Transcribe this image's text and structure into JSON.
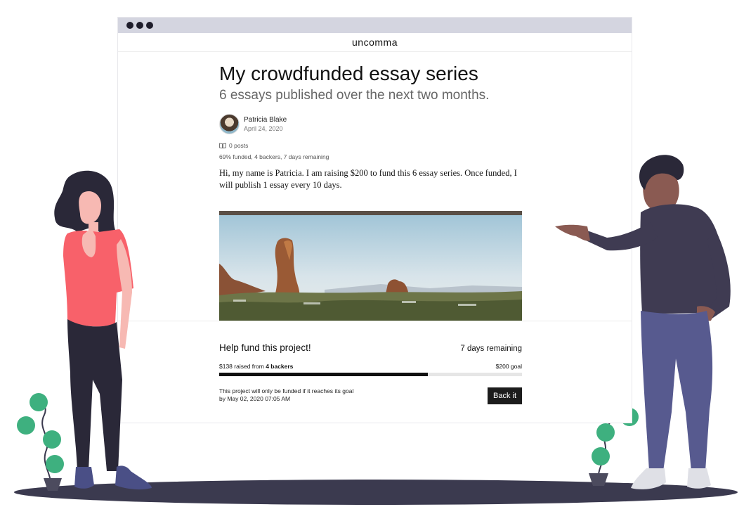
{
  "window": {
    "site_name": "uncomma"
  },
  "article": {
    "title": "My crowdfunded essay series",
    "subtitle": "6 essays published over the next two months.",
    "author_name": "Patricia Blake",
    "date": "April 24, 2020",
    "posts_label": "0 posts",
    "funding_summary": "69% funded, 4 backers, 7 days remaining",
    "body": "Hi, my name is Patricia. I am raising $200 to fund this 6 essay series. Once funded, I will publish 1 essay every 10 days."
  },
  "funding": {
    "heading": "Help fund this project!",
    "days_remaining": "7 days remaining",
    "raised_amount": "$138",
    "raised_from": "raised from",
    "backers": "4 backers",
    "goal": "$200 goal",
    "progress_fraction": 0.69,
    "note_line1": "This project will only be funded if it reaches its goal",
    "note_line2": "by May 02, 2020 07:05 AM",
    "back_button_label": "Back it"
  },
  "colors": {
    "titlebar": "#d4d5e0",
    "ground": "#3b3a4f",
    "woman_shirt": "#f8616a",
    "man_pants": "#575a8f",
    "plant_leaf": "#3eb07f"
  },
  "icons": {
    "posts": "book-icon"
  }
}
